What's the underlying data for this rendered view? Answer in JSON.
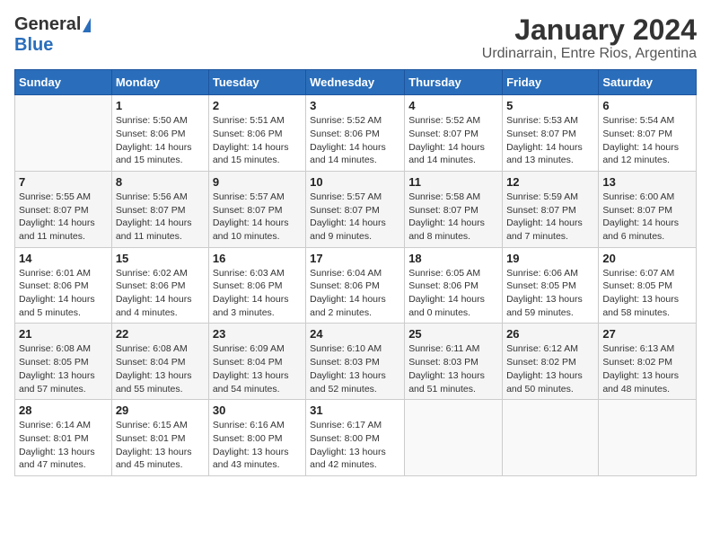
{
  "header": {
    "logo_general": "General",
    "logo_blue": "Blue",
    "title": "January 2024",
    "subtitle": "Urdinarrain, Entre Rios, Argentina"
  },
  "days_of_week": [
    "Sunday",
    "Monday",
    "Tuesday",
    "Wednesday",
    "Thursday",
    "Friday",
    "Saturday"
  ],
  "weeks": [
    [
      {
        "day": "",
        "info": ""
      },
      {
        "day": "1",
        "info": "Sunrise: 5:50 AM\nSunset: 8:06 PM\nDaylight: 14 hours\nand 15 minutes."
      },
      {
        "day": "2",
        "info": "Sunrise: 5:51 AM\nSunset: 8:06 PM\nDaylight: 14 hours\nand 15 minutes."
      },
      {
        "day": "3",
        "info": "Sunrise: 5:52 AM\nSunset: 8:06 PM\nDaylight: 14 hours\nand 14 minutes."
      },
      {
        "day": "4",
        "info": "Sunrise: 5:52 AM\nSunset: 8:07 PM\nDaylight: 14 hours\nand 14 minutes."
      },
      {
        "day": "5",
        "info": "Sunrise: 5:53 AM\nSunset: 8:07 PM\nDaylight: 14 hours\nand 13 minutes."
      },
      {
        "day": "6",
        "info": "Sunrise: 5:54 AM\nSunset: 8:07 PM\nDaylight: 14 hours\nand 12 minutes."
      }
    ],
    [
      {
        "day": "7",
        "info": "Sunrise: 5:55 AM\nSunset: 8:07 PM\nDaylight: 14 hours\nand 11 minutes."
      },
      {
        "day": "8",
        "info": "Sunrise: 5:56 AM\nSunset: 8:07 PM\nDaylight: 14 hours\nand 11 minutes."
      },
      {
        "day": "9",
        "info": "Sunrise: 5:57 AM\nSunset: 8:07 PM\nDaylight: 14 hours\nand 10 minutes."
      },
      {
        "day": "10",
        "info": "Sunrise: 5:57 AM\nSunset: 8:07 PM\nDaylight: 14 hours\nand 9 minutes."
      },
      {
        "day": "11",
        "info": "Sunrise: 5:58 AM\nSunset: 8:07 PM\nDaylight: 14 hours\nand 8 minutes."
      },
      {
        "day": "12",
        "info": "Sunrise: 5:59 AM\nSunset: 8:07 PM\nDaylight: 14 hours\nand 7 minutes."
      },
      {
        "day": "13",
        "info": "Sunrise: 6:00 AM\nSunset: 8:07 PM\nDaylight: 14 hours\nand 6 minutes."
      }
    ],
    [
      {
        "day": "14",
        "info": "Sunrise: 6:01 AM\nSunset: 8:06 PM\nDaylight: 14 hours\nand 5 minutes."
      },
      {
        "day": "15",
        "info": "Sunrise: 6:02 AM\nSunset: 8:06 PM\nDaylight: 14 hours\nand 4 minutes."
      },
      {
        "day": "16",
        "info": "Sunrise: 6:03 AM\nSunset: 8:06 PM\nDaylight: 14 hours\nand 3 minutes."
      },
      {
        "day": "17",
        "info": "Sunrise: 6:04 AM\nSunset: 8:06 PM\nDaylight: 14 hours\nand 2 minutes."
      },
      {
        "day": "18",
        "info": "Sunrise: 6:05 AM\nSunset: 8:06 PM\nDaylight: 14 hours\nand 0 minutes."
      },
      {
        "day": "19",
        "info": "Sunrise: 6:06 AM\nSunset: 8:05 PM\nDaylight: 13 hours\nand 59 minutes."
      },
      {
        "day": "20",
        "info": "Sunrise: 6:07 AM\nSunset: 8:05 PM\nDaylight: 13 hours\nand 58 minutes."
      }
    ],
    [
      {
        "day": "21",
        "info": "Sunrise: 6:08 AM\nSunset: 8:05 PM\nDaylight: 13 hours\nand 57 minutes."
      },
      {
        "day": "22",
        "info": "Sunrise: 6:08 AM\nSunset: 8:04 PM\nDaylight: 13 hours\nand 55 minutes."
      },
      {
        "day": "23",
        "info": "Sunrise: 6:09 AM\nSunset: 8:04 PM\nDaylight: 13 hours\nand 54 minutes."
      },
      {
        "day": "24",
        "info": "Sunrise: 6:10 AM\nSunset: 8:03 PM\nDaylight: 13 hours\nand 52 minutes."
      },
      {
        "day": "25",
        "info": "Sunrise: 6:11 AM\nSunset: 8:03 PM\nDaylight: 13 hours\nand 51 minutes."
      },
      {
        "day": "26",
        "info": "Sunrise: 6:12 AM\nSunset: 8:02 PM\nDaylight: 13 hours\nand 50 minutes."
      },
      {
        "day": "27",
        "info": "Sunrise: 6:13 AM\nSunset: 8:02 PM\nDaylight: 13 hours\nand 48 minutes."
      }
    ],
    [
      {
        "day": "28",
        "info": "Sunrise: 6:14 AM\nSunset: 8:01 PM\nDaylight: 13 hours\nand 47 minutes."
      },
      {
        "day": "29",
        "info": "Sunrise: 6:15 AM\nSunset: 8:01 PM\nDaylight: 13 hours\nand 45 minutes."
      },
      {
        "day": "30",
        "info": "Sunrise: 6:16 AM\nSunset: 8:00 PM\nDaylight: 13 hours\nand 43 minutes."
      },
      {
        "day": "31",
        "info": "Sunrise: 6:17 AM\nSunset: 8:00 PM\nDaylight: 13 hours\nand 42 minutes."
      },
      {
        "day": "",
        "info": ""
      },
      {
        "day": "",
        "info": ""
      },
      {
        "day": "",
        "info": ""
      }
    ]
  ]
}
